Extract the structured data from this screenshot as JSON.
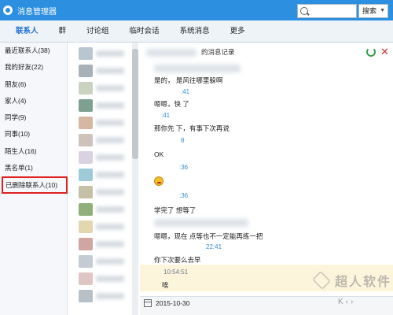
{
  "window": {
    "title": "消息管理器"
  },
  "tabs": [
    {
      "label": "联系人"
    },
    {
      "label": "群"
    },
    {
      "label": "讨论组"
    },
    {
      "label": "临时会话"
    },
    {
      "label": "系统消息"
    },
    {
      "label": "更多"
    }
  ],
  "search": {
    "button_label": "搜索"
  },
  "groups": [
    {
      "label": "最近联系人(38)"
    },
    {
      "label": "我的好友(22)"
    },
    {
      "label": "朋友(6)"
    },
    {
      "label": "家人(4)"
    },
    {
      "label": "同学(9)"
    },
    {
      "label": "同事(10)"
    },
    {
      "label": "陌生人(16)"
    },
    {
      "label": "黑名单(1)"
    },
    {
      "label": "已删除联系人(10)"
    }
  ],
  "chat": {
    "header": "的消息记录",
    "messages": [
      {
        "text": "是的，    是风往哪里躲啊"
      },
      {
        "time": ":41"
      },
      {
        "text": "嗯嗯，快   了"
      },
      {
        "time": ":41"
      },
      {
        "text": "那你先       下，有事下次再说"
      },
      {
        "time": "8"
      },
      {
        "text": "OK"
      },
      {
        "time": ":36"
      },
      {
        "time": ":36"
      },
      {
        "text": "学完了      想等了"
      },
      {
        "text": "嗯嗯，现在       点等也不一定能再练一把"
      },
      {
        "time": "22:41"
      },
      {
        "text": "你下次要么去早"
      },
      {
        "time": "10:54:51"
      },
      {
        "text": "唉"
      }
    ],
    "date": "2015-10-30"
  },
  "watermark": {
    "text": "超人软件"
  }
}
